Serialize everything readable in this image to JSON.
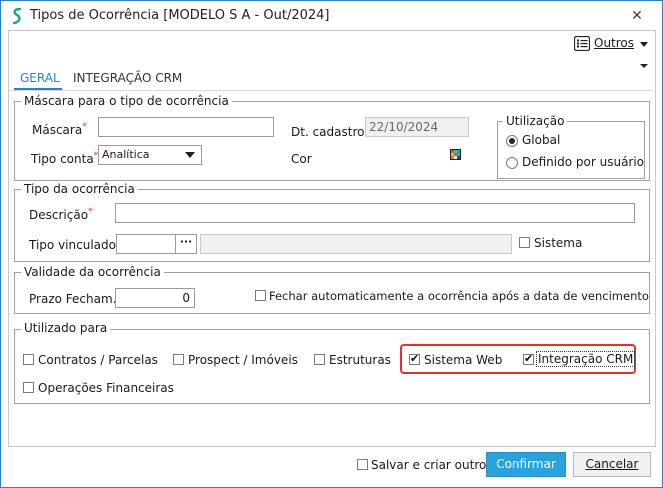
{
  "window": {
    "title": "Tipos de Ocorrência [MODELO S A - Out/2024]",
    "close_glyph": "✕"
  },
  "toolbar": {
    "outros_label": "Outros"
  },
  "tabs": [
    {
      "label": "GERAL"
    },
    {
      "label": "INTEGRAÇÃO CRM"
    }
  ],
  "mascara_group": {
    "title": "Máscara para o tipo de ocorrência",
    "mascara_label": "Máscara",
    "required_mark": "*",
    "mascara_value": "",
    "dt_cadastro_label": "Dt. cadastro",
    "dt_cadastro_value": "22/10/2024",
    "tipo_conta_label": "Tipo conta",
    "tipo_conta_value": "Analítica",
    "cor_label": "Cor",
    "utilizacao": {
      "title": "Utilização",
      "options": [
        {
          "label": "Global",
          "selected": true
        },
        {
          "label": "Definido por usuário",
          "selected": false
        }
      ]
    }
  },
  "tipo_group": {
    "title": "Tipo da ocorrência",
    "descricao_label": "Descrição",
    "descricao_value": "",
    "tipo_vinculado_label": "Tipo vinculado",
    "ellipsis": "···",
    "sistema_label": "Sistema",
    "sistema_checked": false
  },
  "validade_group": {
    "title": "Validade da ocorrência",
    "prazo_label": "Prazo Fecham.",
    "prazo_value": "0",
    "fechar_label": "Fechar automaticamente a ocorrência após a data de vencimento",
    "fechar_checked": false
  },
  "utilizado_group": {
    "title": "Utilizado para",
    "contratos_label": "Contratos / Parcelas",
    "contratos_checked": false,
    "prospect_label": "Prospect / Imóveis",
    "prospect_checked": false,
    "estruturas_label": "Estruturas",
    "estruturas_checked": false,
    "sistema_web_label": "Sistema Web",
    "sistema_web_checked": true,
    "integracao_crm_label": "Integração CRM",
    "integracao_crm_checked": true,
    "operacoes_label": "Operações Financeiras",
    "operacoes_checked": false
  },
  "footer": {
    "salvar_label": "Salvar e criar outro",
    "salvar_checked": false,
    "confirmar_label": "Confirmar",
    "cancelar_label": "Cancelar"
  },
  "colors": {
    "accent": "#2b7fd0",
    "primary_button": "#2aa3db",
    "highlight": "#e0312f",
    "required": "#e03030"
  },
  "icons": [
    "app-logo-icon",
    "close-icon",
    "list-menu-icon",
    "dropdown-arrow-icon",
    "ellipsis-icon",
    "color-picker-icon"
  ]
}
